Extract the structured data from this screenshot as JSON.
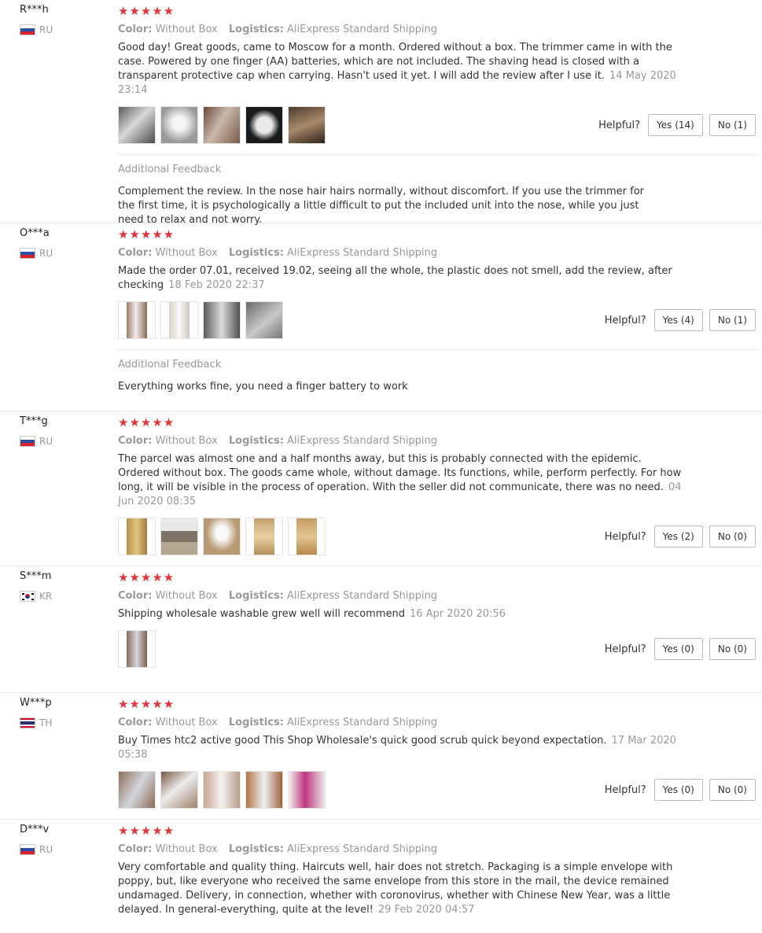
{
  "reviews": [
    {
      "name": "R***h",
      "country": "RU",
      "stars": "★★★★★",
      "color_label": "Color:",
      "color_value": "Without Box",
      "logistics_label": "Logistics:",
      "logistics_value": "AliExpress Standard Shipping",
      "text": "Good day! Great goods, came to Moscow for a month. Ordered without a box. The trimmer came in with the case. Powered by one finger (AA) batteries, which are not included. The shaving head is closed with a transparent protective cap when carrying. Hasn't used it yet. I will add the review after I use it.",
      "date": "14 May 2020 23:14",
      "helpful_label": "Helpful?",
      "yes": "Yes (14)",
      "no": "No (1)",
      "extra_title": "Additional Feedback",
      "extra_text": "Complement the review. In the nose hair hairs normally, without discomfort. If you use the trimmer for the first time, it is psychologically a little difficult to put the included unit into the nose, while you just need to relax and not worry."
    },
    {
      "name": "O***a",
      "country": "RU",
      "stars": "★★★★★",
      "color_label": "Color:",
      "color_value": "Without Box",
      "logistics_label": "Logistics:",
      "logistics_value": "AliExpress Standard Shipping",
      "text": "Made the order 07.01, received 19.02, seeing all the whole, the plastic does not smell, add the review, after checking",
      "date": "18 Feb 2020 22:37",
      "helpful_label": "Helpful?",
      "yes": "Yes (4)",
      "no": "No (1)",
      "extra_title": "Additional Feedback",
      "extra_text": "Everything works fine, you need a finger battery to work"
    },
    {
      "name": "T***g",
      "country": "RU",
      "stars": "★★★★★",
      "color_label": "Color:",
      "color_value": "Without Box",
      "logistics_label": "Logistics:",
      "logistics_value": "AliExpress Standard Shipping",
      "text": "The parcel was almost one and a half months away, but this is probably connected with the epidemic. Ordered without box. The goods came whole, without damage. Its functions, while, perform perfectly. For how long, it will be visible in the process of operation. With the seller did not communicate, there was no need.",
      "date": "04 Jun 2020 08:35",
      "helpful_label": "Helpful?",
      "yes": "Yes (2)",
      "no": "No (0)"
    },
    {
      "name": "S***m",
      "country": "KR",
      "stars": "★★★★★",
      "color_label": "Color:",
      "color_value": "Without Box",
      "logistics_label": "Logistics:",
      "logistics_value": "AliExpress Standard Shipping",
      "text": "Shipping wholesale washable grew well will recommend",
      "date": "16 Apr 2020 20:56",
      "helpful_label": "Helpful?",
      "yes": "Yes (0)",
      "no": "No (0)"
    },
    {
      "name": "W***p",
      "country": "TH",
      "stars": "★★★★★",
      "color_label": "Color:",
      "color_value": "Without Box",
      "logistics_label": "Logistics:",
      "logistics_value": "AliExpress Standard Shipping",
      "text": "Buy Times htc2 active good This Shop Wholesale's quick good scrub quick beyond expectation.",
      "date": "17 Mar 2020 05:38",
      "helpful_label": "Helpful?",
      "yes": "Yes (0)",
      "no": "No (0)"
    },
    {
      "name": "D***v",
      "country": "RU",
      "stars": "★★★★★",
      "color_label": "Color:",
      "color_value": "Without Box",
      "logistics_label": "Logistics:",
      "logistics_value": "AliExpress Standard Shipping",
      "text": "Very comfortable and quality thing. Haircuts well, hair does not stretch. Packaging is a simple envelope with poppy, but, like everyone who received the same envelope from this store in the mail, the device remained undamaged. Delivery, in connection, whether with coronovirus, whether with Chinese New Year, was a little delayed. In general-everything, quite at the level!",
      "date": "29 Feb 2020 04:57"
    }
  ],
  "colors": {
    "star": "#e3343c",
    "muted": "#999999",
    "divider": "#e8e8e8"
  }
}
